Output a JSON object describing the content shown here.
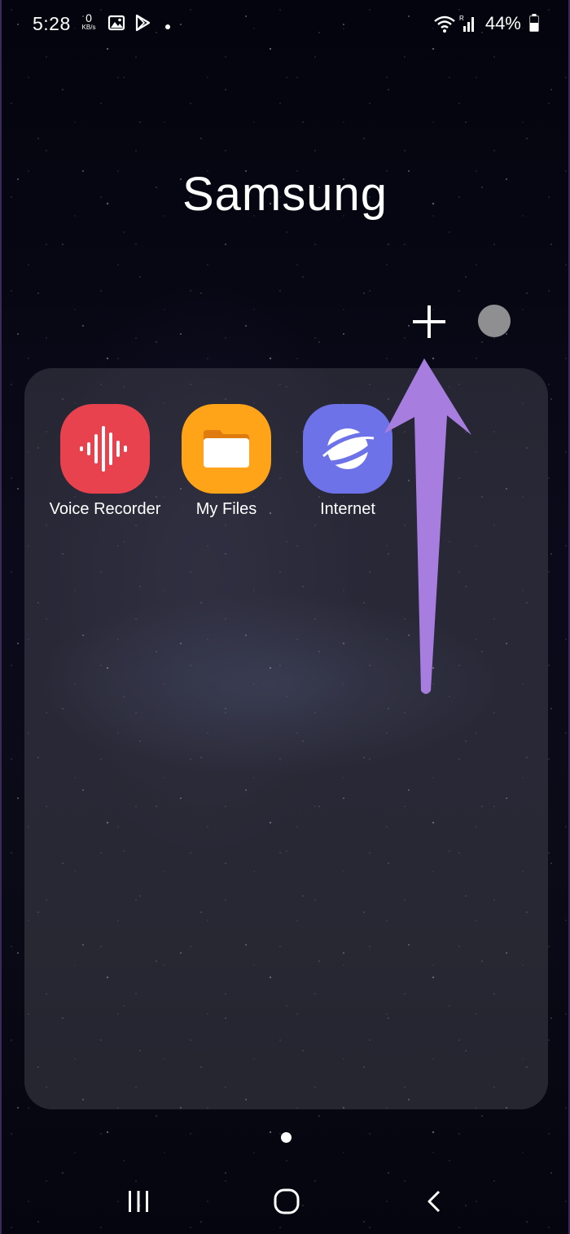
{
  "status_bar": {
    "time": "5:28",
    "network_speed_value": "0",
    "network_speed_unit": "KB/s",
    "battery_percent": "44%",
    "icons": [
      "image-notification-icon",
      "play-store-icon",
      "notification-dot-icon",
      "wifi-icon",
      "signal-icon",
      "battery-icon"
    ]
  },
  "folder": {
    "title": "Samsung",
    "add_button_icon": "plus-icon",
    "color_dot_color": "#8f8f92",
    "apps": [
      {
        "label": "Voice Recorder",
        "icon": "voice-recorder-icon",
        "color": "#e8424f"
      },
      {
        "label": "My Files",
        "icon": "folder-icon",
        "color": "#ffa418"
      },
      {
        "label": "Internet",
        "icon": "planet-icon",
        "color": "#6e72e8"
      }
    ]
  },
  "annotation": {
    "arrow_color": "#a77ee0"
  },
  "navigation": {
    "recents_icon": "recents-icon",
    "home_icon": "home-icon",
    "back_icon": "back-icon"
  }
}
